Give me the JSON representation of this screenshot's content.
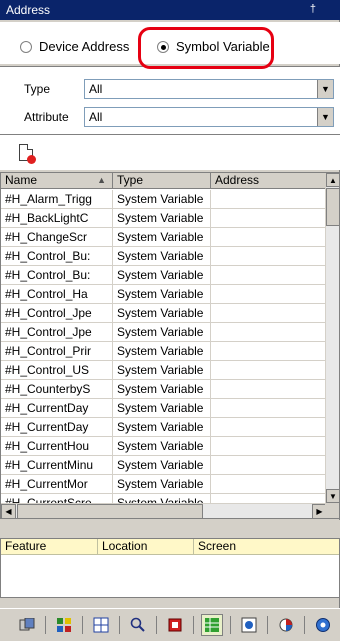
{
  "window": {
    "title": "Address",
    "pin_glyph": "†",
    "close_glyph": "×"
  },
  "mode": {
    "device_label": "Device Address",
    "symbol_label": "Symbol Variable",
    "selected": "symbol"
  },
  "filters": {
    "type_label": "Type",
    "type_value": "All",
    "attribute_label": "Attribute",
    "attribute_value": "All"
  },
  "table": {
    "columns": [
      "Name",
      "Type",
      "Address"
    ],
    "rows": [
      {
        "name": "#H_Alarm_Trigg",
        "type": "System Variable",
        "address": ""
      },
      {
        "name": "#H_BackLightC",
        "type": "System Variable",
        "address": ""
      },
      {
        "name": "#H_ChangeScr",
        "type": "System Variable",
        "address": ""
      },
      {
        "name": "#H_Control_Bu:",
        "type": "System Variable",
        "address": ""
      },
      {
        "name": "#H_Control_Bu:",
        "type": "System Variable",
        "address": ""
      },
      {
        "name": "#H_Control_Ha",
        "type": "System Variable",
        "address": ""
      },
      {
        "name": "#H_Control_Jpe",
        "type": "System Variable",
        "address": ""
      },
      {
        "name": "#H_Control_Jpe",
        "type": "System Variable",
        "address": ""
      },
      {
        "name": "#H_Control_Prir",
        "type": "System Variable",
        "address": ""
      },
      {
        "name": "#H_Control_US",
        "type": "System Variable",
        "address": ""
      },
      {
        "name": "#H_CounterbyS",
        "type": "System Variable",
        "address": ""
      },
      {
        "name": "#H_CurrentDay",
        "type": "System Variable",
        "address": ""
      },
      {
        "name": "#H_CurrentDay",
        "type": "System Variable",
        "address": ""
      },
      {
        "name": "#H_CurrentHou",
        "type": "System Variable",
        "address": ""
      },
      {
        "name": "#H_CurrentMinu",
        "type": "System Variable",
        "address": ""
      },
      {
        "name": "#H_CurrentMor",
        "type": "System Variable",
        "address": ""
      },
      {
        "name": "#H_CurrentScre",
        "type": "System Variable",
        "address": ""
      }
    ]
  },
  "lower_table": {
    "columns": [
      "Feature",
      "Location",
      "Screen"
    ]
  },
  "colors": {
    "highlight": "#e60012",
    "titlebar": "#0a246a"
  },
  "bottom_toolbar": {
    "icons": [
      "screen-list-icon",
      "parts-icon",
      "window-icon",
      "search-icon",
      "alarm-icon",
      "address-icon",
      "cross-reference-icon",
      "resources-icon",
      "info-icon"
    ]
  }
}
